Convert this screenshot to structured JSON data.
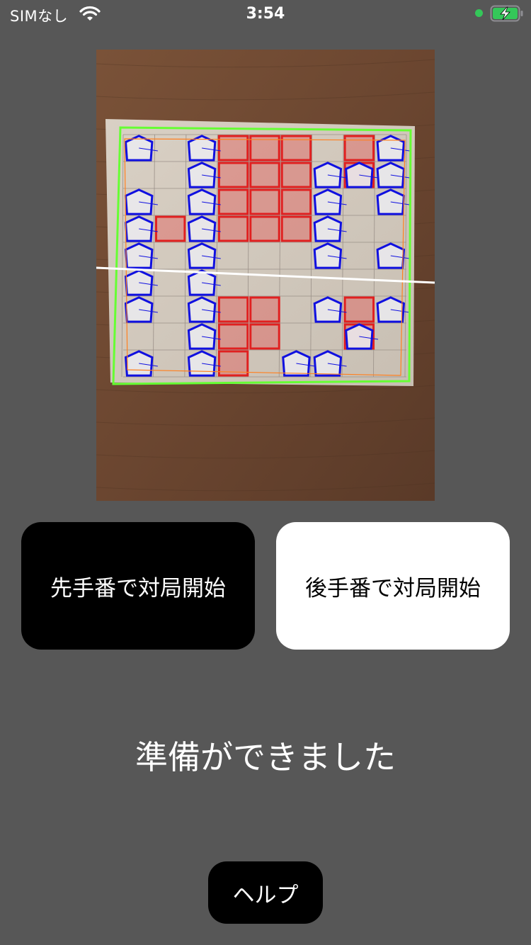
{
  "status_bar": {
    "carrier": "SIMなし",
    "time": "3:54",
    "mic_indicator_color": "#34c759",
    "battery_color": "#34c759",
    "battery_state": "charging"
  },
  "camera": {
    "board_outline_color": "#66ff33",
    "piece_box_color": "#1010e0",
    "empty_cell_color": "#e02020",
    "horizon_line_color": "#ffffff",
    "grid_line_color": "#ff8020"
  },
  "buttons": {
    "start_first": "先手番で対局開始",
    "start_second": "後手番で対局開始",
    "help": "ヘルプ"
  },
  "message": "準備ができました",
  "colors": {
    "background": "#575757",
    "primary_button": "#000000",
    "secondary_button": "#ffffff"
  }
}
